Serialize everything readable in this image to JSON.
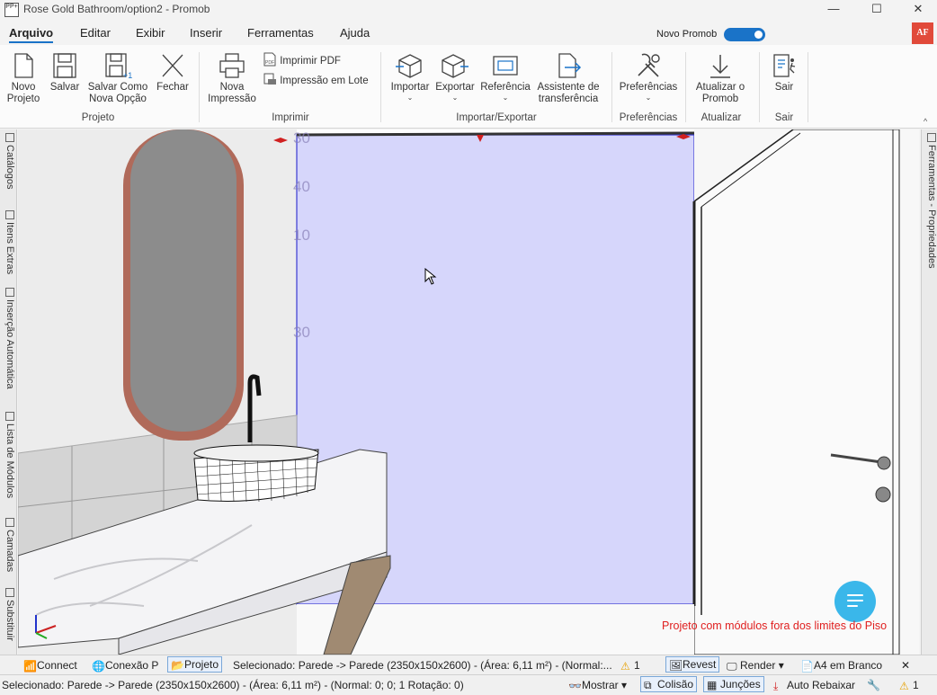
{
  "window": {
    "title": "Rose Gold Bathroom/option2 - Promob",
    "app_icon_text": "PP+",
    "minimize_glyph": "—",
    "maximize_glyph": "☐",
    "close_glyph": "✕"
  },
  "menu": {
    "items": [
      "Arquivo",
      "Editar",
      "Exibir",
      "Inserir",
      "Ferramentas",
      "Ajuda"
    ],
    "active": "Arquivo",
    "novo_promob_label": "Novo Promob",
    "user_badge": "AF"
  },
  "ribbon": {
    "projeto": {
      "group_label": "Projeto",
      "novo_projeto": "Novo Projeto",
      "salvar": "Salvar",
      "salvar_como": "Salvar Como Nova Opção",
      "fechar": "Fechar"
    },
    "imprimir": {
      "group_label": "Imprimir",
      "nova_impressao": "Nova Impressão",
      "imprimir_pdf": "Imprimir PDF",
      "impressao_lote": "Impressão em Lote"
    },
    "importar_exportar": {
      "group_label": "Importar/Exportar",
      "importar": "Importar",
      "exportar": "Exportar",
      "referencia": "Referência",
      "assistente": "Assistente de transferência"
    },
    "preferencias": {
      "group_label": "Preferências",
      "preferencias": "Preferências"
    },
    "atualizar": {
      "group_label": "Atualizar",
      "atualizar_promob": "Atualizar o Promob"
    },
    "sair": {
      "group_label": "Sair",
      "sair": "Sair"
    }
  },
  "left_panel": {
    "tabs": [
      "Catálogos",
      "Itens Extras",
      "Inserção Automática",
      "Lista de Módulos",
      "Camadas",
      "Substituir"
    ]
  },
  "right_panel": {
    "tabs": [
      "Ferramentas - Propriedades"
    ]
  },
  "viewport": {
    "ruler_labels": [
      "30",
      "40",
      "10",
      "30"
    ],
    "warning_text": "Projeto com módulos fora dos limites do Piso",
    "wall_highlight_color": "#d6d6fb",
    "countertop_color": "#f4f4f6",
    "mirror_frame_color": "#b06a5a",
    "chat_button_color": "#3ab7ea"
  },
  "status_bar_top": {
    "connect": "Connect",
    "conexao": "Conexão P",
    "projeto": "Projeto",
    "selected": "Selecionado: Parede -> Parede (2350x150x2600) - (Área: 6,11 m²) - (Normal:...",
    "warnings": "1",
    "revest": "Revest",
    "render": "Render",
    "a4": "A4 em Branco",
    "close": "✕"
  },
  "status_bar_bottom": {
    "selected": "Selecionado: Parede -> Parede (2350x150x2600) - (Área: 6,11 m²) - (Normal: 0; 0; 1 Rotação: 0)",
    "mostrar": "Mostrar",
    "colisao": "Colisão",
    "juncoes": "Junções",
    "auto_rebaixar": "Auto Rebaixar",
    "warnings": "1"
  }
}
